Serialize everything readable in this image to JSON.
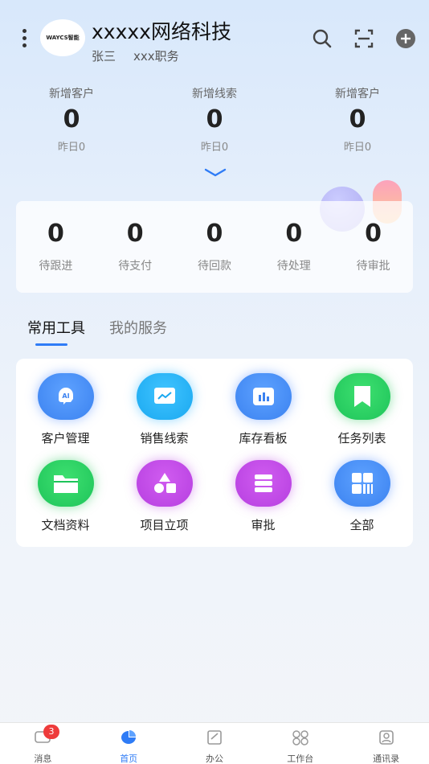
{
  "header": {
    "logo_text": "WAYCS智能",
    "company": "xxxxx网络科技",
    "user_name": "张三",
    "position": "xxx职务"
  },
  "stats": [
    {
      "label": "新增客户",
      "value": "0",
      "sub": "昨日0"
    },
    {
      "label": "新增线索",
      "value": "0",
      "sub": "昨日0"
    },
    {
      "label": "新增客户",
      "value": "0",
      "sub": "昨日0"
    }
  ],
  "pending": [
    {
      "value": "0",
      "label": "待跟进"
    },
    {
      "value": "0",
      "label": "待支付"
    },
    {
      "value": "0",
      "label": "待回款"
    },
    {
      "value": "0",
      "label": "待处理"
    },
    {
      "value": "0",
      "label": "待审批"
    }
  ],
  "tabs": [
    {
      "label": "常用工具"
    },
    {
      "label": "我的服务"
    }
  ],
  "tools": [
    {
      "label": "客户管理",
      "icon": "ai-icon",
      "color": "blue"
    },
    {
      "label": "销售线索",
      "icon": "trend-chart-icon",
      "color": "cyan"
    },
    {
      "label": "库存看板",
      "icon": "bar-chart-icon",
      "color": "blue"
    },
    {
      "label": "任务列表",
      "icon": "bookmark-icon",
      "color": "green"
    },
    {
      "label": "文档资料",
      "icon": "folder-icon",
      "color": "green"
    },
    {
      "label": "项目立项",
      "icon": "shapes-icon",
      "color": "purple"
    },
    {
      "label": "审批",
      "icon": "stack-icon",
      "color": "purple"
    },
    {
      "label": "全部",
      "icon": "grid-icon",
      "color": "blue"
    }
  ],
  "nav": [
    {
      "label": "消息",
      "badge": "3"
    },
    {
      "label": "首页"
    },
    {
      "label": "办公"
    },
    {
      "label": "工作台"
    },
    {
      "label": "通讯录"
    }
  ],
  "colors": {
    "accent": "#2f7cf6",
    "badge": "#ee3b3b"
  }
}
